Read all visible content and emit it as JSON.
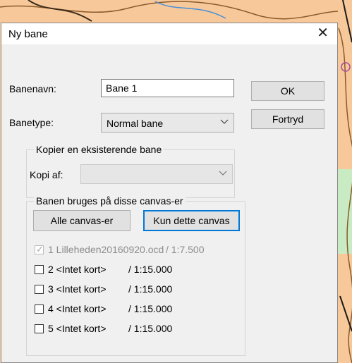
{
  "dialog": {
    "title": "Ny bane",
    "close_icon": "close-icon"
  },
  "form": {
    "banenavn_label": "Banenavn:",
    "banenavn_value": "Bane 1",
    "banetype_label": "Banetype:",
    "banetype_value": "Normal bane"
  },
  "buttons": {
    "ok": "OK",
    "cancel": "Fortryd"
  },
  "copy_group": {
    "title": "Kopier en eksisterende bane",
    "kopi_label": "Kopi af:",
    "kopi_value": ""
  },
  "canvas_group": {
    "title": "Banen bruges på disse canvas-er",
    "all_button": "Alle canvas-er",
    "only_button": "Kun dette canvas",
    "items": [
      {
        "name": "1 Lilleheden20160920.ocd",
        "scale": "/ 1:7.500",
        "checked": true,
        "disabled": true
      },
      {
        "name": "2 <Intet kort>",
        "scale": "/ 1:15.000",
        "checked": false,
        "disabled": false
      },
      {
        "name": "3 <Intet kort>",
        "scale": "/ 1:15.000",
        "checked": false,
        "disabled": false
      },
      {
        "name": "4 <Intet kort>",
        "scale": "/ 1:15.000",
        "checked": false,
        "disabled": false
      },
      {
        "name": "5 <Intet kort>",
        "scale": "/ 1:15.000",
        "checked": false,
        "disabled": false
      }
    ]
  },
  "colors": {
    "focus_border": "#0078d7",
    "dialog_bg": "#f0f0f0",
    "map_orange": "#f7c99a",
    "map_green": "#c9ebc4"
  }
}
